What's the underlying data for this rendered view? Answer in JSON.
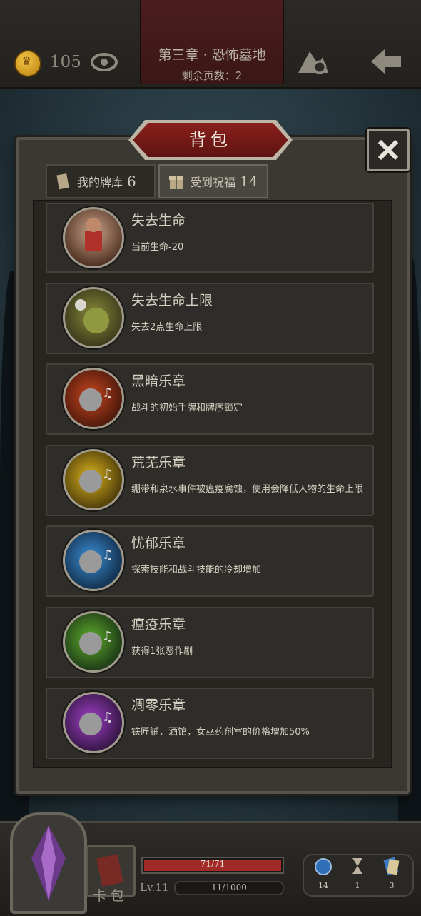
{
  "topbar": {
    "chapter_title": "第三章 · 恐怖墓地",
    "pages_left": "剩余页数：2",
    "gold": "105"
  },
  "panel": {
    "title": "背包",
    "tabs": [
      {
        "label": "我的牌库",
        "count": "6"
      },
      {
        "label": "受到祝福",
        "count": "14"
      }
    ]
  },
  "items": [
    {
      "name": "失去生命",
      "desc": "当前生命-20",
      "icon": "bleeding-man-icon"
    },
    {
      "name": "失去生命上限",
      "desc": "失去2点生命上限",
      "icon": "ghost-zombie-icon"
    },
    {
      "name": "黑暗乐章",
      "desc": "战斗的初始手牌和牌序锁定",
      "icon": "dark-music-skull-icon",
      "color": "#c7461f"
    },
    {
      "name": "荒芜乐章",
      "desc": "绷带和泉水事件被瘟疫腐蚀，使用会降低人物的生命上限",
      "icon": "barren-music-skull-icon",
      "color": "#d9b21d"
    },
    {
      "name": "忧郁乐章",
      "desc": "探索技能和战斗技能的冷却增加",
      "icon": "melancholy-music-skull-icon",
      "color": "#3b8fd6"
    },
    {
      "name": "瘟疫乐章",
      "desc": "获得1张恶作剧",
      "icon": "plague-music-skull-icon",
      "color": "#5fae2a"
    },
    {
      "name": "凋零乐章",
      "desc": "铁匠铺，酒馆，女巫药剂室的价格增加50%",
      "icon": "withering-music-skull-icon",
      "color": "#a040c8"
    }
  ],
  "bottombar": {
    "card_pack_label": "卡包",
    "hp": "71/71",
    "hp_fraction": 1.0,
    "level": "Lv.11",
    "xp": "11/1000",
    "inventory": [
      {
        "icon": "potion-icon",
        "count": "14"
      },
      {
        "icon": "hourglass-icon",
        "count": "1"
      },
      {
        "icon": "scroll-icon",
        "count": "3"
      }
    ]
  }
}
